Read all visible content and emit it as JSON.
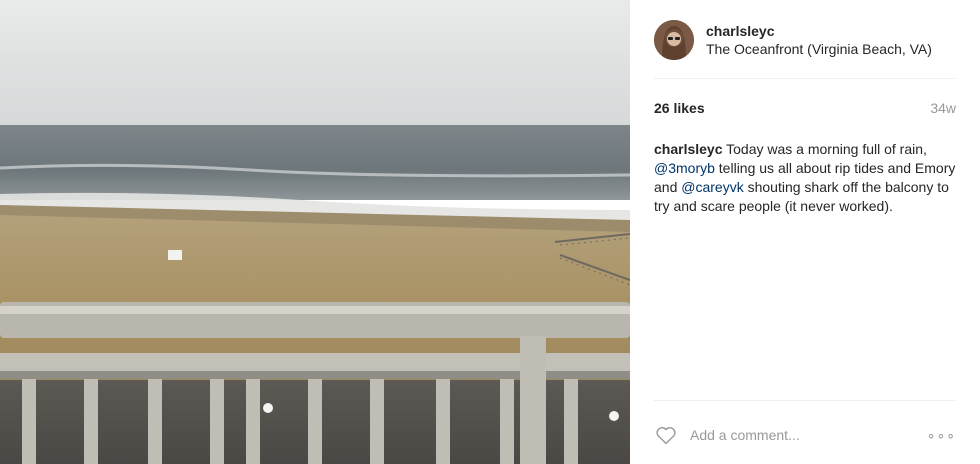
{
  "post": {
    "username": "charlsleyc",
    "location": "The Oceanfront (Virginia Beach, VA)",
    "likes": "26 likes",
    "age": "34w",
    "caption": {
      "author": "charlsleyc",
      "text1": " Today was a morning full of rain, ",
      "mention1": "@3moryb",
      "text2": " telling us all about rip tides and Emory and ",
      "mention2": "@careyvk",
      "text3": " shouting shark off the balcony to try and scare people (it never worked)."
    }
  },
  "comment_box": {
    "placeholder": "Add a comment...",
    "more_label": "∘∘∘"
  },
  "icons": {
    "heart": "heart-icon",
    "more": "more-options-icon"
  },
  "colors": {
    "mention": "#003569",
    "muted": "#999999"
  }
}
